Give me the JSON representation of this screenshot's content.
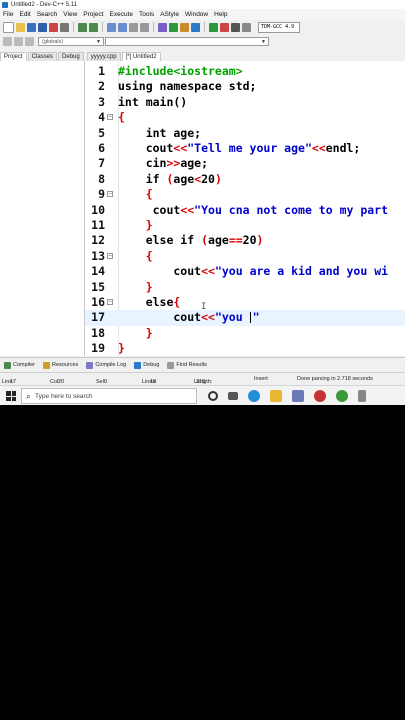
{
  "window": {
    "title": "Untitled2 - Dev-C++ 5.11"
  },
  "menu": [
    "File",
    "Edit",
    "Search",
    "View",
    "Project",
    "Execute",
    "Tools",
    "AStyle",
    "Window",
    "Help"
  ],
  "toolbar": {
    "compiler": "TDM-GCC 4.9"
  },
  "toolbar2": {
    "globals": "(globals)"
  },
  "pane_tabs": [
    "Project",
    "Classes",
    "Debug"
  ],
  "file_tabs": [
    "yyyyy.cpp",
    "[*] Untitled2"
  ],
  "editor": {
    "lines": [
      {
        "n": "1",
        "segments": [
          [
            "pp",
            "#include<iostream>"
          ]
        ]
      },
      {
        "n": "2",
        "segments": [
          [
            "kw",
            "using namespace std;"
          ]
        ]
      },
      {
        "n": "3",
        "segments": [
          [
            "kw",
            "int main()"
          ]
        ]
      },
      {
        "n": "4",
        "segments": [
          [
            "brace",
            "{"
          ]
        ]
      },
      {
        "n": "5",
        "segments": [
          [
            "kw",
            "    int age;"
          ]
        ]
      },
      {
        "n": "6",
        "segments": [
          [
            "kw",
            "    cout"
          ],
          [
            "op",
            "<<"
          ],
          [
            "str",
            "\"Tell me your age\""
          ],
          [
            "op",
            "<<"
          ],
          [
            "kw",
            "endl;"
          ]
        ]
      },
      {
        "n": "7",
        "segments": [
          [
            "kw",
            "    cin"
          ],
          [
            "op",
            ">>"
          ],
          [
            "kw",
            "age;"
          ]
        ]
      },
      {
        "n": "8",
        "segments": [
          [
            "kw",
            "    if "
          ],
          [
            "op",
            "("
          ],
          [
            "kw",
            "age"
          ],
          [
            "op",
            "<"
          ],
          [
            "num",
            "20"
          ],
          [
            "op",
            ")"
          ]
        ]
      },
      {
        "n": "9",
        "segments": [
          [
            "brace",
            "    {"
          ]
        ]
      },
      {
        "n": "10",
        "segments": [
          [
            "kw",
            "     cout"
          ],
          [
            "op",
            "<<"
          ],
          [
            "str",
            "\"You cna not come to my part"
          ]
        ]
      },
      {
        "n": "11",
        "segments": [
          [
            "brace",
            "    }"
          ]
        ]
      },
      {
        "n": "12",
        "segments": [
          [
            "kw",
            "    else if "
          ],
          [
            "op",
            "("
          ],
          [
            "kw",
            "age"
          ],
          [
            "op",
            "=="
          ],
          [
            "num",
            "20"
          ],
          [
            "op",
            ")"
          ]
        ]
      },
      {
        "n": "13",
        "segments": [
          [
            "brace",
            "    {"
          ]
        ]
      },
      {
        "n": "14",
        "segments": [
          [
            "kw",
            "        cout"
          ],
          [
            "op",
            "<<"
          ],
          [
            "str",
            "\"you are a kid and you wi"
          ]
        ]
      },
      {
        "n": "15",
        "segments": [
          [
            "brace",
            "    }"
          ]
        ]
      },
      {
        "n": "16",
        "segments": [
          [
            "kw",
            "    else"
          ],
          [
            "brace",
            "{"
          ]
        ]
      },
      {
        "n": "17",
        "segments": [
          [
            "kw",
            "        cout"
          ],
          [
            "op",
            "<<"
          ],
          [
            "str",
            "\"you \""
          ]
        ]
      },
      {
        "n": "18",
        "segments": [
          [
            "brace",
            "    }"
          ]
        ]
      },
      {
        "n": "19",
        "segments": [
          [
            "brace",
            "}"
          ]
        ]
      }
    ]
  },
  "bottom_tabs": [
    "Compiler",
    "Resources",
    "Compile Log",
    "Debug",
    "Find Results"
  ],
  "status": {
    "line_label": "Line:",
    "line": "17",
    "col_label": "Col:",
    "col": "20",
    "sel_label": "Sel:",
    "sel": "0",
    "lines_label": "Lines:",
    "lines": "19",
    "length_label": "Length:",
    "length": "315",
    "mode": "Insert",
    "message": "Done parsing in 2.718 seconds"
  },
  "taskbar": {
    "search_placeholder": "Type here to search"
  },
  "colors": {
    "preprocessor": "#00a000",
    "string": "#0000cc",
    "operator": "#d80000"
  }
}
